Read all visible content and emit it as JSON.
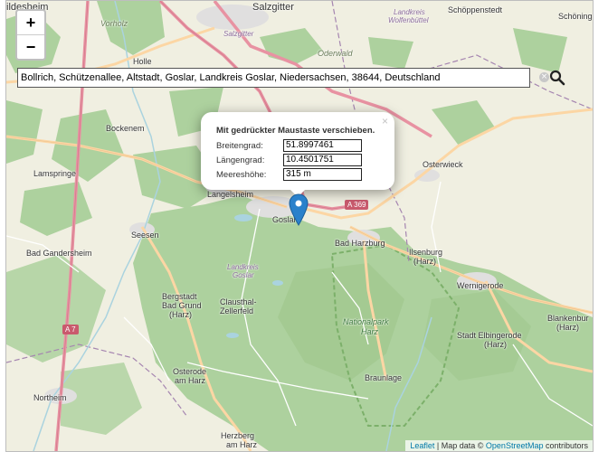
{
  "search": {
    "value": "Bollrich, Schützenallee, Altstadt, Goslar, Landkreis Goslar, Niedersachsen, 38644, Deutschland",
    "clear_glyph": "×"
  },
  "zoom": {
    "in_label": "+",
    "out_label": "−"
  },
  "popup": {
    "close_glyph": "×",
    "title": "Mit gedrückter Maustaste verschieben.",
    "lat_label": "Breitengrad:",
    "lat_value": "51.8997461",
    "lng_label": "Längengrad:",
    "lng_value": "10.4501751",
    "elev_label": "Meereshöhe:",
    "elev_value": "315 m"
  },
  "attribution": {
    "leaflet": "Leaflet",
    "sep": " | Map data © ",
    "osm": "OpenStreetMap",
    "suffix": " contributors"
  },
  "roads": {
    "a369": "A 369",
    "a7": "A 7"
  },
  "places": {
    "salzgitter": "Salzgitter",
    "hildesheim_partial": "ildesheim",
    "schoeppenstedt": "Schöppenstedt",
    "schoening_partial": "Schöning",
    "vorholz": "Vorholz",
    "holle": "Holle",
    "oderwald": "Oderwald",
    "lk_salzgitter_1": "Salzgitter",
    "lk_wolfenbuettel_1": "Landkreis",
    "lk_wolfenbuettel_2": "Wolfenbüttel",
    "bockenem": "Bockenem",
    "lamspringe": "Lamspringe",
    "osterwieck": "Osterwieck",
    "langelsheim": "Langelsheim",
    "goslar": "Goslar",
    "seesen": "Seesen",
    "bad_harzburg": "Bad Harzburg",
    "ilsenburg_1": "Ilsenburg",
    "ilsenburg_2": "(Harz)",
    "bad_gandersheim": "Bad Gandersheim",
    "lk_goslar_1": "Landkreis",
    "lk_goslar_2": "Goslar",
    "wernigerode": "Wernigerode",
    "bergstadt_1": "Bergstadt",
    "bergstadt_2": "Bad Grund",
    "bergstadt_3": "(Harz)",
    "clausthal_1": "Clausthal-",
    "clausthal_2": "Zellerfeld",
    "blankenburg_1": "Blankenbur",
    "blankenburg_2": "(Harz)",
    "nationalpark_1": "Nationalpark",
    "nationalpark_2": "Harz",
    "elbingerode_1": "Stadt Elbingerode",
    "elbingerode_2": "(Harz)",
    "osterode_1": "Osterode",
    "osterode_2": "am Harz",
    "braunlage": "Braunlage",
    "northeim": "Northeim",
    "herzberg_1": "Herzberg",
    "herzberg_2": "am Harz"
  },
  "colors": {
    "land": "#f2efe9",
    "forest": "#add19e",
    "forest_dark": "#9ec58a",
    "motorway": "#e892a2",
    "primary": "#fcd6a4",
    "urban": "#e0dfdf",
    "water": "#aad3df",
    "marker": "#2a81cb",
    "admin_border": "#a585b0"
  }
}
